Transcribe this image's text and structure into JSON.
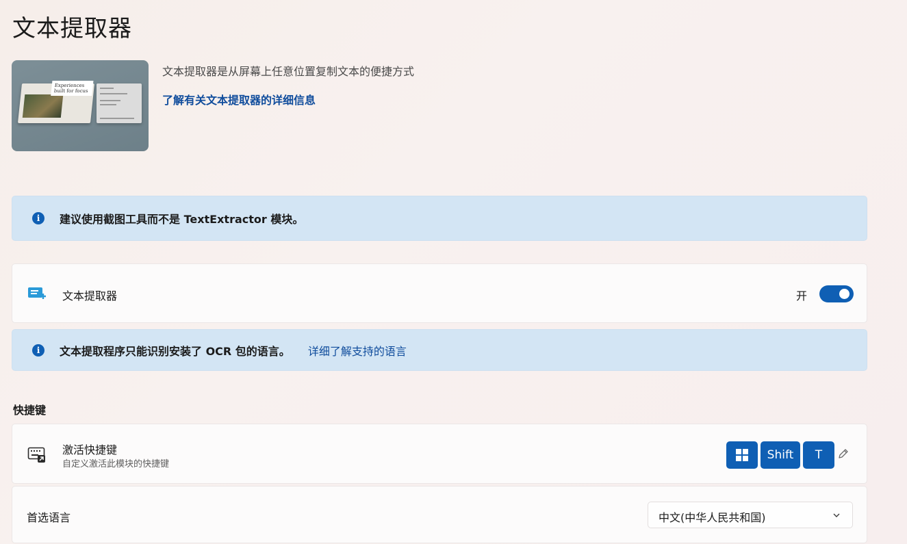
{
  "page": {
    "title": "文本提取器"
  },
  "hero": {
    "image_text": "Experiences built for focus",
    "description": "文本提取器是从屏幕上任意位置复制文本的便捷方式",
    "learn_more_link": "了解有关文本提取器的详细信息"
  },
  "info_recommend": {
    "text": "建议使用截图工具而不是 TextExtractor 模块。"
  },
  "module_toggle": {
    "label": "文本提取器",
    "state_label": "开",
    "enabled": true
  },
  "info_ocr": {
    "text": "文本提取程序只能识别安装了 OCR 包的语言。",
    "link": "详细了解支持的语言"
  },
  "shortcut_section": {
    "heading": "快捷键",
    "activation": {
      "title": "激活快捷键",
      "subtitle": "自定义激活此模块的快捷键",
      "keys": [
        "⊞",
        "Shift",
        "T"
      ]
    }
  },
  "language": {
    "label": "首选语言",
    "selected": "中文(中华人民共和国)"
  },
  "colors": {
    "accent": "#0f5fb4",
    "link": "#0f4c9c",
    "infobar_bg": "#d3e5f4"
  },
  "icons": {
    "module": "text-extractor-icon",
    "keyboard": "keyboard-shortcut-icon",
    "info": "info-icon",
    "edit": "pencil-icon",
    "chevron": "chevron-down-icon",
    "windows_key": "windows-logo-icon"
  }
}
